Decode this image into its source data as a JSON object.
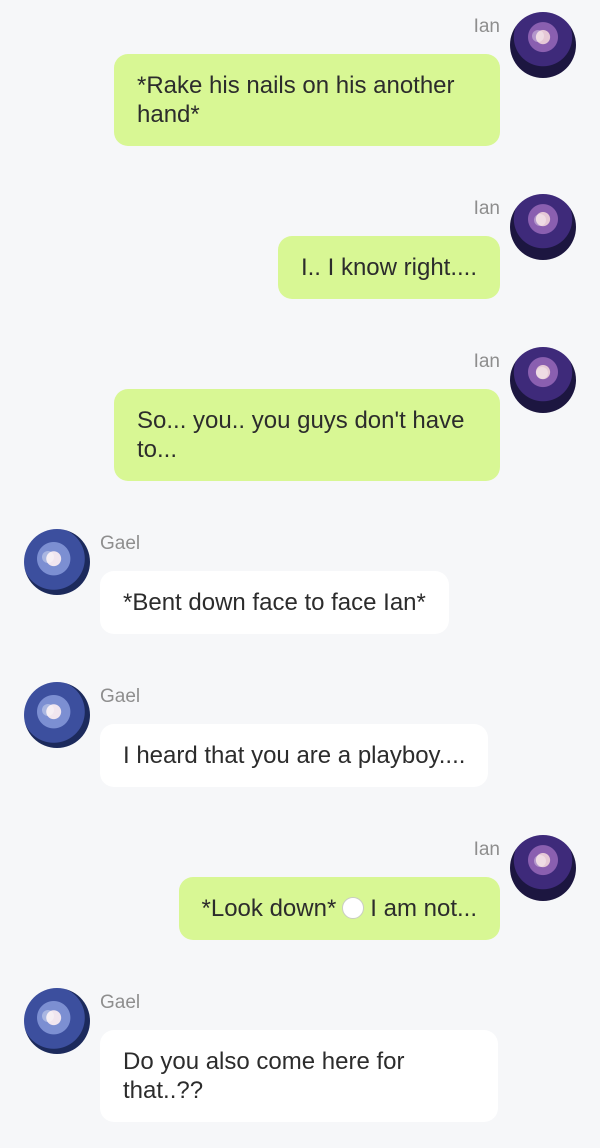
{
  "users": {
    "ian": {
      "name": "Ian",
      "avatar_icon": "ian-portrait-icon"
    },
    "gael": {
      "name": "Gael",
      "avatar_icon": "gael-portrait-icon"
    }
  },
  "colors": {
    "background": "#f6f7f9",
    "ian_bubble": "#d8f794",
    "gael_bubble": "#ffffff",
    "name_text": "#8e8e8e",
    "message_text": "#2c2c2c"
  },
  "messages": [
    {
      "sender": "Ian",
      "text": "*Rake his nails on his another hand*"
    },
    {
      "sender": "Ian",
      "text": "I.. I know right...."
    },
    {
      "sender": "Ian",
      "text": "So... you.. you guys don't have to..."
    },
    {
      "sender": "Gael",
      "text": "*Bent down face to face Ian*"
    },
    {
      "sender": "Gael",
      "text": "I heard that you are a playboy...."
    },
    {
      "sender": "Ian",
      "text_before": "*Look down*",
      "emoji": "thought-bubble-icon",
      "text_after": "I am not..."
    },
    {
      "sender": "Gael",
      "text": "Do you also come here for that..??"
    }
  ]
}
